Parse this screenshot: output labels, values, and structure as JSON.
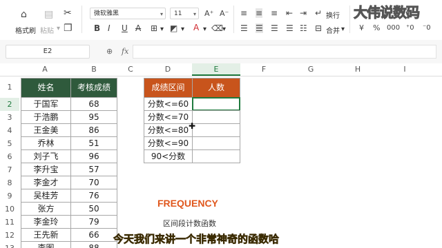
{
  "ribbon": {
    "format_painter": "格式刷",
    "paste": "粘贴",
    "font_name": "微软雅黑",
    "font_size": "11",
    "wrap_text": "换行",
    "merge": "合并",
    "watermark": "大伟说数码"
  },
  "formula_bar": {
    "name_box": "E2",
    "fx": "fx",
    "formula": ""
  },
  "grid": {
    "columns": [
      "A",
      "B",
      "C",
      "D",
      "E",
      "F",
      "G",
      "H",
      "I"
    ],
    "rows": [
      "1",
      "2",
      "3",
      "4",
      "5",
      "6",
      "7",
      "8",
      "9",
      "10",
      "11",
      "12",
      "13"
    ],
    "selected_column": "E",
    "selected_row": "2"
  },
  "table1": {
    "headers": [
      "姓名",
      "考核成绩"
    ],
    "rows": [
      [
        "于国军",
        "68"
      ],
      [
        "于浩鹏",
        "95"
      ],
      [
        "王金美",
        "86"
      ],
      [
        "乔林",
        "51"
      ],
      [
        "刘子飞",
        "96"
      ],
      [
        "李升宝",
        "57"
      ],
      [
        "李金才",
        "70"
      ],
      [
        "吴桂芳",
        "76"
      ],
      [
        "张方",
        "50"
      ],
      [
        "李金玲",
        "79"
      ],
      [
        "王先新",
        "66"
      ],
      [
        "李图",
        "88"
      ]
    ]
  },
  "table2": {
    "headers": [
      "成绩区间",
      "人数"
    ],
    "rows": [
      "分数<=60",
      "分数<=70",
      "分数<=80",
      "分数<=90",
      "90<分数"
    ]
  },
  "overlay": {
    "function_name": "FREQUENCY",
    "function_desc": "区间段计数函数",
    "subtitle": "今天我们来讲一个非常神奇的函数哈"
  },
  "colors": {
    "green_header": "#2f5a3c",
    "orange_header": "#c8541c",
    "function_name": "#e0571d",
    "selection": "#1f7a3e"
  }
}
